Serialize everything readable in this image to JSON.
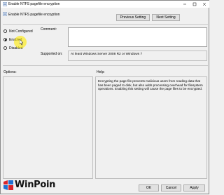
{
  "window": {
    "title": "Enable NTFS pagefile encryption",
    "minimize_icon": "minimize-icon",
    "maximize_icon": "maximize-icon",
    "close_icon": "close-icon"
  },
  "header": {
    "policy_title": "Enable NTFS pagefile encryption",
    "previous_label": "Previous Setting",
    "next_label": "Next Setting"
  },
  "state": {
    "options": [
      {
        "label": "Not Configured",
        "checked": false
      },
      {
        "label": "Enabled",
        "checked": true
      },
      {
        "label": "Disabled",
        "checked": false
      }
    ]
  },
  "comment": {
    "label": "Comment:",
    "value": ""
  },
  "supported": {
    "label": "Supported on:",
    "value": "At least Windows Server 2008 R2 or Windows 7"
  },
  "options_panel": {
    "label": "Options:"
  },
  "help_panel": {
    "label": "Help:",
    "text": "Encrypting the page file prevents malicious users from reading data that has been paged to disk, but also adds processing overhead for filesystem operations.  Enabling this setting will cause the page files to be encrypted."
  },
  "footer": {
    "ok_label": "OK",
    "cancel_label": "Cancel",
    "apply_label": "Apply"
  },
  "watermark": {
    "brand": "WinPoin"
  },
  "colors": {
    "highlight": "#ffeb00",
    "logo_red": "#d8242b",
    "logo_blue": "#1f6fd1"
  }
}
